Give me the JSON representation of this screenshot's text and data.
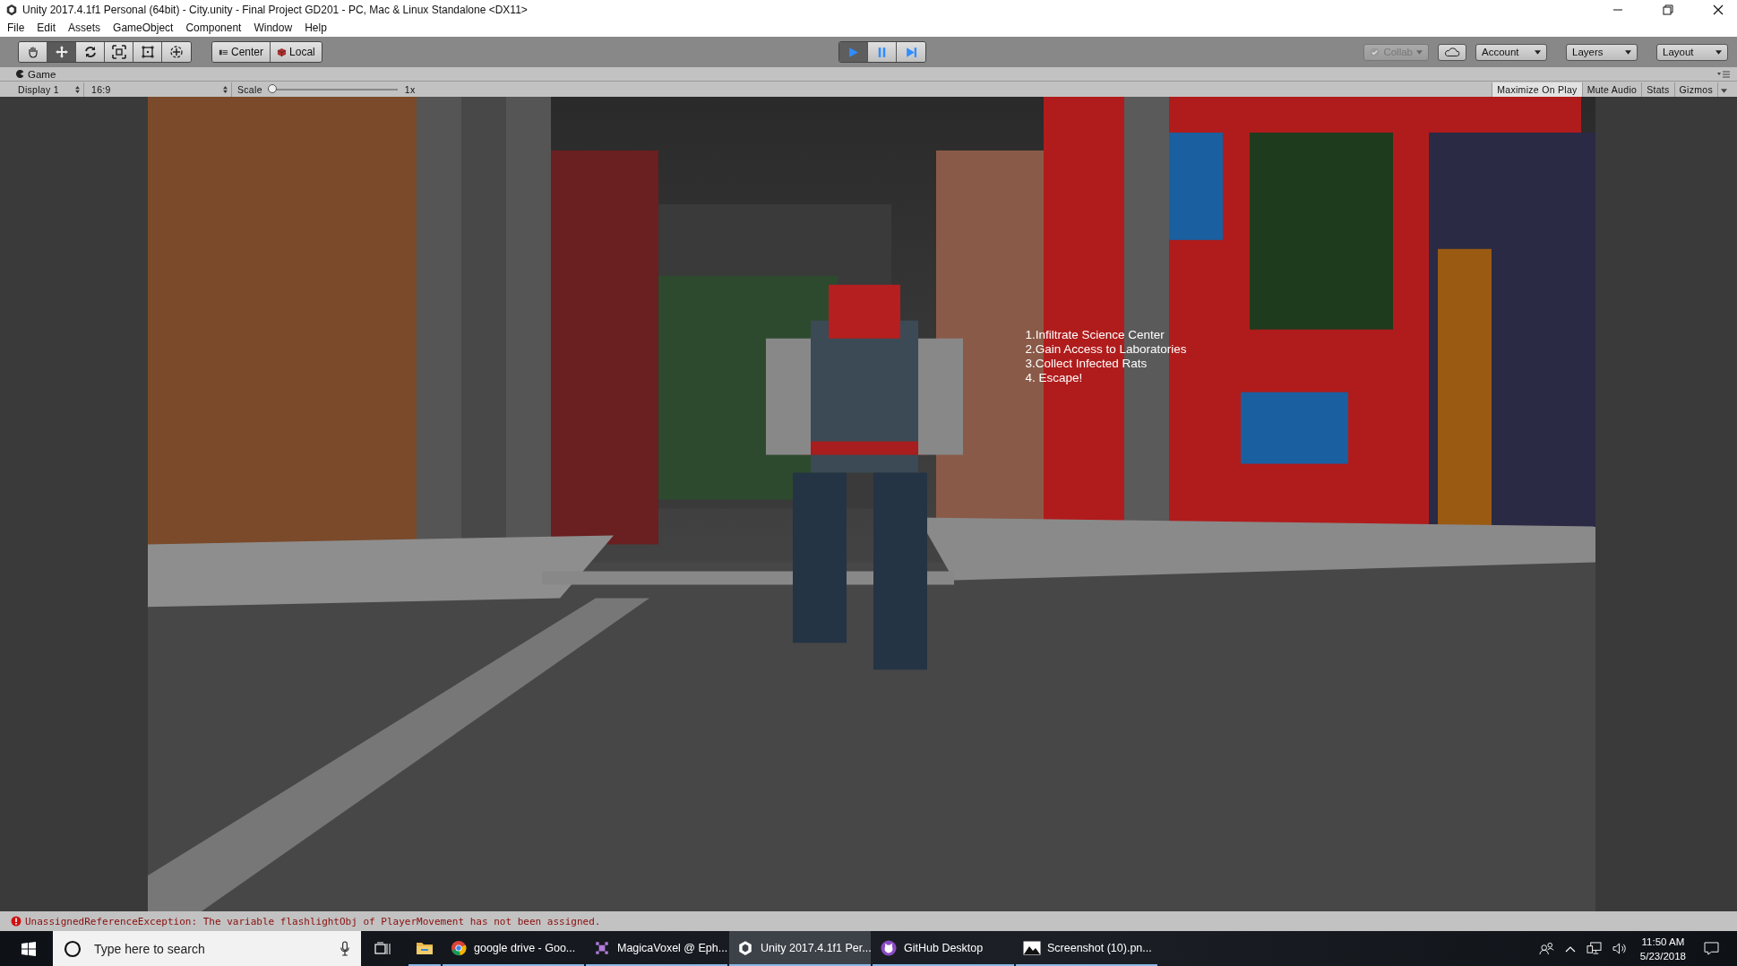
{
  "window": {
    "title": "Unity 2017.4.1f1 Personal (64bit) - City.unity - Final Project GD201 - PC, Mac & Linux Standalone <DX11>"
  },
  "menu": [
    "File",
    "Edit",
    "Assets",
    "GameObject",
    "Component",
    "Window",
    "Help"
  ],
  "tools": [
    {
      "kind": "hand",
      "selected": false
    },
    {
      "kind": "move",
      "selected": true
    },
    {
      "kind": "rotate",
      "selected": false
    },
    {
      "kind": "scale",
      "selected": false
    },
    {
      "kind": "rect",
      "selected": false
    },
    {
      "kind": "transform",
      "selected": false
    }
  ],
  "pivot_buttons": [
    {
      "kind": "center",
      "label": "Center"
    },
    {
      "kind": "local",
      "label": "Local"
    }
  ],
  "playback": [
    {
      "kind": "play",
      "on": true
    },
    {
      "kind": "pause",
      "on": false
    },
    {
      "kind": "step",
      "on": false
    }
  ],
  "collab": {
    "label": "Collab",
    "disabled": true
  },
  "dropdowns": [
    "Account",
    "Layers",
    "Layout"
  ],
  "game_panel": {
    "tab": "Game",
    "display": "Display 1",
    "aspect": "16:9",
    "scale_label": "Scale",
    "scale": {
      "level": 0
    },
    "scale_reading": "1x",
    "toggles": [
      {
        "label": "Maximize On Play",
        "on": true
      },
      {
        "label": "Mute Audio",
        "on": false
      },
      {
        "label": "Stats",
        "on": false
      },
      {
        "label": "Gizmos",
        "on": false
      }
    ]
  },
  "objectives": [
    "1.Infiltrate Science Center",
    "2.Gain Access to Laboratories",
    "3.Collect Infected Rats",
    "4. Escape!"
  ],
  "console_error": "UnassignedReferenceException: The variable flashlightObj of PlayerMovement has not been assigned.",
  "taskbar": {
    "search": {
      "placeholder": "Type here to search"
    },
    "apps": [
      {
        "kind": "explorer",
        "selected": false
      },
      {
        "kind": "chrome",
        "label": "google drive - Goo...",
        "selected": false
      },
      {
        "kind": "voxel",
        "label": "MagicaVoxel @ Eph...",
        "selected": false
      },
      {
        "kind": "unity",
        "label": "Unity 2017.4.1f1 Per...",
        "selected": true
      },
      {
        "kind": "github",
        "label": "GitHub Desktop",
        "selected": false
      },
      {
        "kind": "image",
        "label": "Screenshot (10).pn...",
        "selected": false
      }
    ],
    "clock": {
      "time": "11:50 AM",
      "date": "5/23/2018"
    }
  }
}
